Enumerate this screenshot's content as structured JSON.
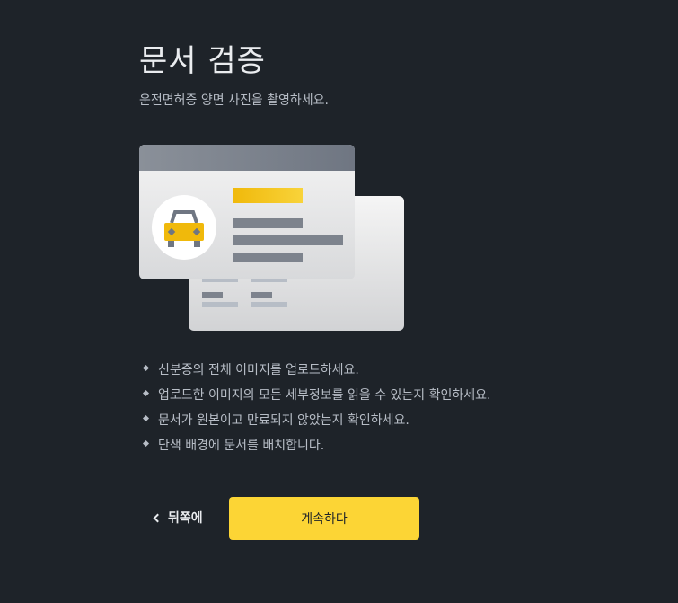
{
  "header": {
    "title": "문서 검증",
    "subtitle": "운전면허증 양면 사진을 촬영하세요."
  },
  "illustration": {
    "icon": "car-icon",
    "accent_color": "#f0b90b"
  },
  "tips": [
    "신분증의 전체 이미지를 업로드하세요.",
    "업로드한 이미지의 모든 세부정보를 읽을 수 있는지 확인하세요.",
    "문서가 원본이고 만료되지 않았는지 확인하세요.",
    "단색 배경에 문서를 배치합니다."
  ],
  "actions": {
    "back_label": "뒤쪽에",
    "continue_label": "계속하다"
  },
  "colors": {
    "background": "#1e2329",
    "primary_button": "#fcd535"
  }
}
